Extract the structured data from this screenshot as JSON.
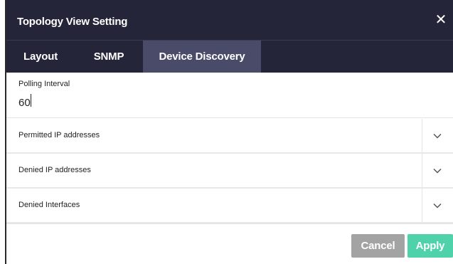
{
  "dialog": {
    "title": "Topology View Setting",
    "close_icon": "close-icon",
    "colors": {
      "header_bg": "#242538",
      "active_tab_bg": "#4a4b68",
      "apply_bg": "#4fd1a9",
      "cancel_bg": "#a3a3a3"
    }
  },
  "tabs": [
    {
      "label": "Layout",
      "active": false
    },
    {
      "label": "SNMP",
      "active": false
    },
    {
      "label": "Device Discovery",
      "active": true
    }
  ],
  "polling": {
    "label": "Polling Interval",
    "value": "60"
  },
  "sections": [
    {
      "label": "Permitted IP addresses",
      "icon": "chevron-down-icon"
    },
    {
      "label": "Denied IP addresses",
      "icon": "chevron-down-icon"
    },
    {
      "label": "Denied Interfaces",
      "icon": "chevron-down-icon"
    }
  ],
  "footer": {
    "cancel_label": "Cancel",
    "apply_label": "Apply"
  }
}
